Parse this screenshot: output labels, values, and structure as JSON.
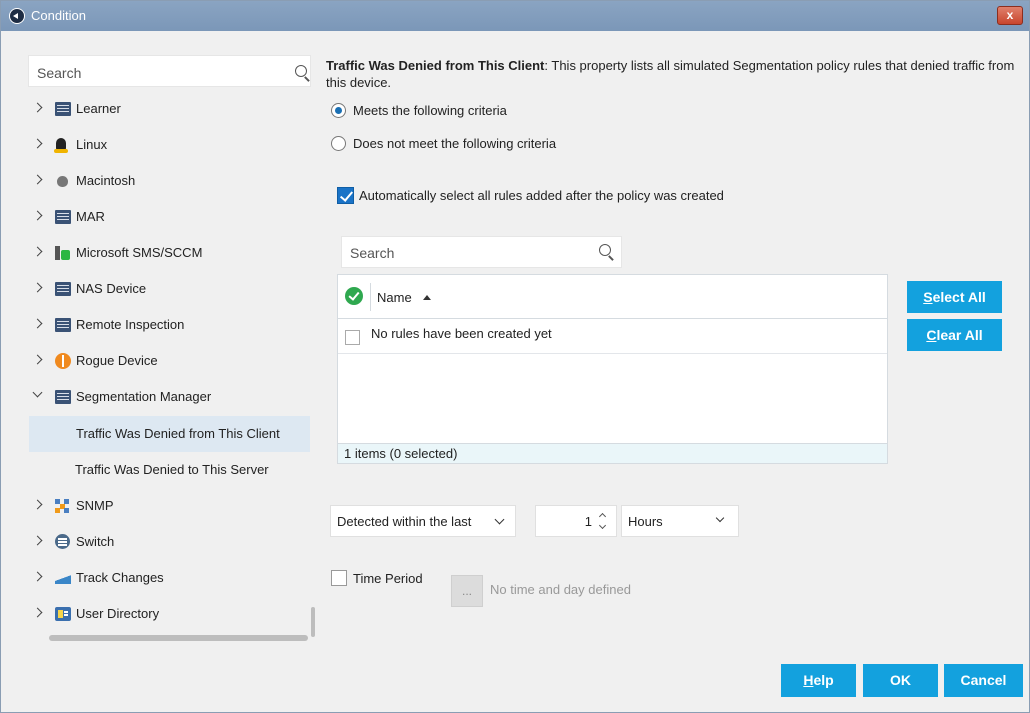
{
  "window": {
    "title": "Condition",
    "close_label": "x"
  },
  "tree": {
    "search_placeholder": "Search",
    "items": [
      {
        "label": "Learner",
        "icon": "list-icon"
      },
      {
        "label": "Linux",
        "icon": "linux-icon"
      },
      {
        "label": "Macintosh",
        "icon": "apple-icon"
      },
      {
        "label": "MAR",
        "icon": "list-icon"
      },
      {
        "label": "Microsoft SMS/SCCM",
        "icon": "sms-icon"
      },
      {
        "label": "NAS Device",
        "icon": "list-icon"
      },
      {
        "label": "Remote Inspection",
        "icon": "list-icon"
      },
      {
        "label": "Rogue Device",
        "icon": "rogue-icon"
      },
      {
        "label": "Segmentation Manager",
        "icon": "list-icon"
      },
      {
        "label": "Traffic Was Denied from This Client"
      },
      {
        "label": "Traffic Was Denied to This Server"
      },
      {
        "label": "SNMP",
        "icon": "snmp-icon"
      },
      {
        "label": "Switch",
        "icon": "switch-icon"
      },
      {
        "label": "Track Changes",
        "icon": "track-changes-icon"
      },
      {
        "label": "User Directory",
        "icon": "user-directory-icon"
      }
    ]
  },
  "details": {
    "title": "Traffic Was Denied from This Client",
    "description": ": This property lists all simulated Segmentation policy rules that denied traffic from this device.",
    "radio_meets": "Meets the following criteria",
    "radio_not_meets": "Does not meet the following criteria",
    "auto_select_label": "Automatically select all rules added after the policy was created",
    "rule_search_placeholder": "Search",
    "table": {
      "column_name": "Name",
      "empty_message": "No rules have been created yet",
      "footer": "1 items (0 selected)"
    },
    "select_all_prefix": "S",
    "select_all_rest": "elect All",
    "clear_all_prefix": "C",
    "clear_all_rest": "lear All",
    "detected_label": "Detected within the last",
    "quantity": "1",
    "unit": "Hours",
    "time_period_label": "Time Period",
    "time_button": "...",
    "time_info": "No time and day defined"
  },
  "footer": {
    "help_prefix": "H",
    "help_rest": "elp",
    "ok": "OK",
    "cancel": "Cancel"
  },
  "colors": {
    "accent": "#13a1de",
    "titlebar": "#7b97b8",
    "checkbox": "#1a73c7"
  }
}
